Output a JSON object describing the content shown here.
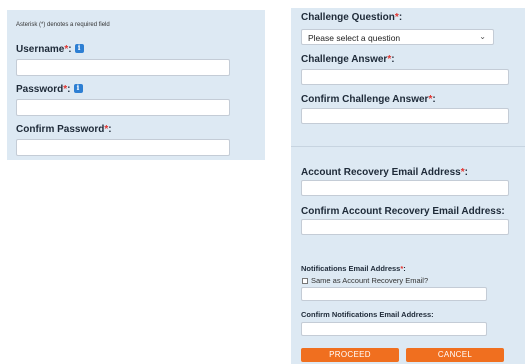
{
  "left_form": {
    "required_note": "Asterisk (*) denotes a required field",
    "username_label": "Username",
    "password_label": "Password",
    "confirm_password_label": "Confirm Password",
    "required_marker": "*",
    "colon": ":"
  },
  "right_form": {
    "challenge_question_label": "Challenge Question",
    "challenge_question_select": "Please select a question",
    "challenge_answer_label": "Challenge Answer",
    "confirm_challenge_answer_label": "Confirm Challenge Answer",
    "recovery_email_label": "Account Recovery Email Address",
    "confirm_recovery_email_label": "Confirm Account Recovery Email Address:",
    "notifications_email_label": "Notifications Email Address",
    "same_as_recovery_label": "Same as Account Recovery Email?",
    "confirm_notifications_email_label": "Confirm Notifications Email Address:",
    "required_marker": "*",
    "colon": ":"
  },
  "buttons": {
    "proceed": "PROCEED",
    "cancel": "CANCEL"
  },
  "colors": {
    "panel_bg": "#dde9f3",
    "accent_orange": "#f06f1f",
    "required_red": "#e0342f",
    "info_blue": "#2d7fd3"
  },
  "icons": [
    "info-icon",
    "chevron-down-icon",
    "checkbox"
  ]
}
